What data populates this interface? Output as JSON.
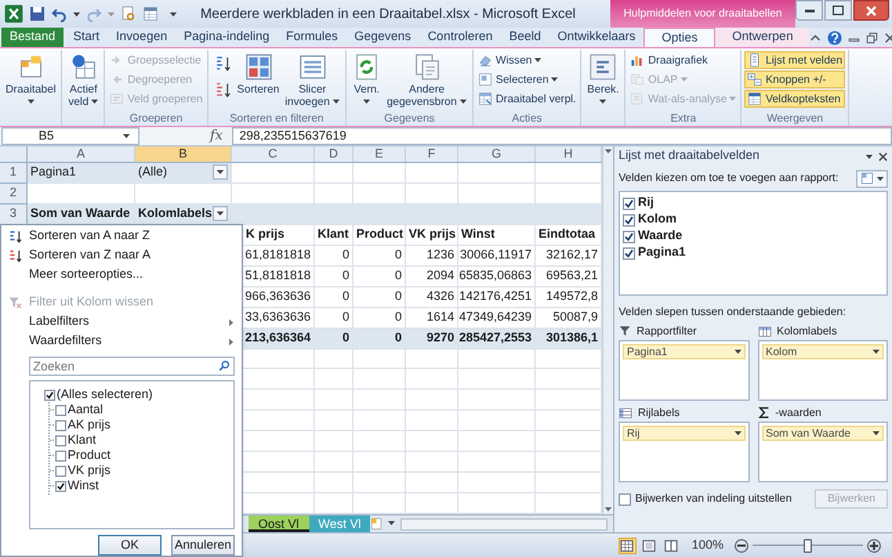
{
  "title_bar": {
    "title": "Meerdere werkbladen in een Draaitabel.xlsx - Microsoft Excel",
    "context_title": "Hulpmiddelen voor draaitabellen"
  },
  "ribbon_tabs": [
    {
      "label": "Bestand",
      "kind": "file",
      "selected": false
    },
    {
      "label": "Start",
      "kind": "tab",
      "selected": false
    },
    {
      "label": "Invoegen",
      "kind": "tab",
      "selected": false
    },
    {
      "label": "Pagina-indeling",
      "kind": "tab",
      "selected": false
    },
    {
      "label": "Formules",
      "kind": "tab",
      "selected": false
    },
    {
      "label": "Gegevens",
      "kind": "tab",
      "selected": false
    },
    {
      "label": "Controleren",
      "kind": "tab",
      "selected": false
    },
    {
      "label": "Beeld",
      "kind": "tab",
      "selected": false
    },
    {
      "label": "Ontwikkelaars",
      "kind": "tab",
      "selected": false
    },
    {
      "label": "Opties",
      "kind": "context",
      "selected": true
    },
    {
      "label": "Ontwerpen",
      "kind": "context",
      "selected": false
    }
  ],
  "ribbon_groups": [
    {
      "items": [
        {
          "kind": "large",
          "label": "Draaitabel",
          "dropdown": true,
          "disabled": false
        }
      ]
    },
    {
      "items": [
        {
          "kind": "large",
          "label": "Actief veld",
          "dropdown": true,
          "disabled": false
        }
      ]
    },
    {
      "label": "Groeperen",
      "items": [
        {
          "kind": "small",
          "label": "Groepsselectie",
          "dropdown": false,
          "disabled": true
        },
        {
          "kind": "small",
          "label": "Degroeperen",
          "dropdown": false,
          "disabled": true
        },
        {
          "kind": "small",
          "label": "Veld groeperen",
          "dropdown": false,
          "disabled": true
        }
      ]
    },
    {
      "label": "Sorteren en filteren",
      "items": [
        {
          "kind": "sort_icons"
        },
        {
          "kind": "large",
          "label": "Sorteren",
          "dropdown": false,
          "disabled": false
        },
        {
          "kind": "large",
          "label": "Slicer invoegen",
          "dropdown": true,
          "disabled": false
        }
      ]
    },
    {
      "label": "Gegevens",
      "items": [
        {
          "kind": "large",
          "label": "Vern.",
          "dropdown": true,
          "disabled": false
        },
        {
          "kind": "large",
          "label": "Andere gegevensbron",
          "dropdown": true,
          "disabled": false
        }
      ]
    },
    {
      "label": "Acties",
      "items": [
        {
          "kind": "small",
          "label": "Wissen",
          "dropdown": true,
          "disabled": false
        },
        {
          "kind": "small",
          "label": "Selecteren",
          "dropdown": true,
          "disabled": false
        },
        {
          "kind": "small",
          "label": "Draaitabel verpl.",
          "dropdown": false,
          "disabled": false
        }
      ]
    },
    {
      "items": [
        {
          "kind": "large",
          "label": "Berek.",
          "dropdown": true,
          "disabled": false
        }
      ]
    },
    {
      "label": "Extra",
      "items": [
        {
          "kind": "small",
          "label": "Draaigrafiek",
          "dropdown": false,
          "disabled": false
        },
        {
          "kind": "small",
          "label": "OLAP",
          "dropdown": true,
          "disabled": true
        },
        {
          "kind": "small",
          "label": "Wat-als-analyse",
          "dropdown": true,
          "disabled": true
        }
      ]
    },
    {
      "label": "Weergeven",
      "items": [
        {
          "kind": "toggle",
          "label": "Lijst met velden",
          "on": true
        },
        {
          "kind": "toggle",
          "label": "Knoppen +/-",
          "on": true
        },
        {
          "kind": "toggle",
          "label": "Veldkopteksten",
          "on": true
        }
      ]
    }
  ],
  "formula_bar": {
    "name_box": "B5",
    "function_label": "fx",
    "value": "298,235515637619"
  },
  "grid": {
    "columns": [
      {
        "label": "A",
        "selected": false
      },
      {
        "label": "B",
        "selected": true
      },
      {
        "label": "C",
        "selected": false
      },
      {
        "label": "D",
        "selected": false
      },
      {
        "label": "E",
        "selected": false
      },
      {
        "label": "F",
        "selected": false
      },
      {
        "label": "G",
        "selected": false
      },
      {
        "label": "H",
        "selected": false
      }
    ],
    "rows": [
      {
        "kind": "filter",
        "number": "1",
        "cells": [
          "Pagina1",
          "(Alle)",
          null,
          null,
          null,
          null,
          null,
          null
        ]
      },
      {
        "kind": "blank",
        "number": "2"
      },
      {
        "kind": "pivot_header",
        "number": "3",
        "cells": [
          "Som van Waarde",
          "Kolomlabels",
          null,
          null,
          null,
          null,
          null,
          null
        ]
      },
      {
        "kind": "column_header",
        "cells": [
          null,
          null,
          "K prijs",
          "Klant",
          "Product",
          "VK prijs",
          "Winst",
          "Eindtotaa"
        ]
      },
      {
        "kind": "data",
        "cells": [
          null,
          null,
          "61,8181818",
          "0",
          "0",
          "1236",
          "30066,11917",
          "32162,17"
        ]
      },
      {
        "kind": "data",
        "cells": [
          null,
          null,
          "51,8181818",
          "0",
          "0",
          "2094",
          "65835,06863",
          "69563,21"
        ]
      },
      {
        "kind": "data",
        "cells": [
          null,
          null,
          "966,363636",
          "0",
          "0",
          "4326",
          "142176,4251",
          "149572,8"
        ]
      },
      {
        "kind": "data",
        "cells": [
          null,
          null,
          "33,6363636",
          "0",
          "0",
          "1614",
          "47349,64239",
          "50087,9"
        ]
      },
      {
        "kind": "total",
        "cells": [
          null,
          null,
          "213,636364",
          "0",
          "0",
          "9270",
          "285427,2553",
          "301386,1"
        ]
      }
    ]
  },
  "filter_menu": {
    "items": [
      {
        "kind": "sort_asc",
        "label": "Sorteren van A naar Z",
        "disabled": false
      },
      {
        "kind": "sort_desc",
        "label": "Sorteren van Z naar A",
        "disabled": false
      },
      {
        "kind": "plain",
        "label": "Meer sorteeropties...",
        "disabled": false
      },
      {
        "kind": "clear_filter",
        "label": "Filter uit Kolom wissen",
        "disabled": true
      },
      {
        "kind": "submenu",
        "label": "Labelfilters",
        "disabled": false
      },
      {
        "kind": "submenu",
        "label": "Waardefilters",
        "disabled": false
      }
    ],
    "search": {
      "placeholder": "Zoeken"
    },
    "values": [
      {
        "label": "(Alles selecteren)",
        "checked": true
      },
      {
        "label": "Aantal",
        "checked": false
      },
      {
        "label": "AK prijs",
        "checked": false
      },
      {
        "label": "Klant",
        "checked": false
      },
      {
        "label": "Product",
        "checked": false
      },
      {
        "label": "VK prijs",
        "checked": false
      },
      {
        "label": "Winst",
        "checked": true
      }
    ],
    "buttons": [
      "OK",
      "Annuleren"
    ]
  },
  "sheet_tabs": [
    {
      "label": "Oost Vl",
      "selected": true,
      "color": "#9bd15c"
    },
    {
      "label": "West Vl",
      "selected": false,
      "color": "#3fa9c0"
    }
  ],
  "field_list": {
    "title": "Lijst met draaitabelvelden",
    "choose_label": "Velden kiezen om toe te voegen aan rapport:",
    "fields": [
      {
        "label": "Rij",
        "checked": true
      },
      {
        "label": "Kolom",
        "checked": true
      },
      {
        "label": "Waarde",
        "checked": true
      },
      {
        "label": "Pagina1",
        "checked": true
      }
    ],
    "drag_label": "Velden slepen tussen onderstaande gebieden:",
    "areas": [
      {
        "kind": "filter",
        "label": "Rapportfilter",
        "items": [
          "Pagina1"
        ]
      },
      {
        "kind": "columns",
        "label": "Kolomlabels",
        "items": [
          "Kolom"
        ]
      },
      {
        "kind": "rows",
        "label": "Rijlabels",
        "items": [
          "Rij"
        ]
      },
      {
        "kind": "values",
        "label": "-waarden",
        "items": [
          "Som van Waarde"
        ]
      }
    ],
    "defer": {
      "label": "Bijwerken van indeling uitstellen",
      "checked": false
    },
    "update_button": {
      "label": "Bijwerken",
      "disabled": true
    }
  },
  "status_bar": {
    "views": [
      {
        "selected": true
      },
      {
        "selected": false
      },
      {
        "selected": false
      }
    ],
    "zoom": "100%",
    "zoom_slider": {
      "level": 0.5
    }
  }
}
